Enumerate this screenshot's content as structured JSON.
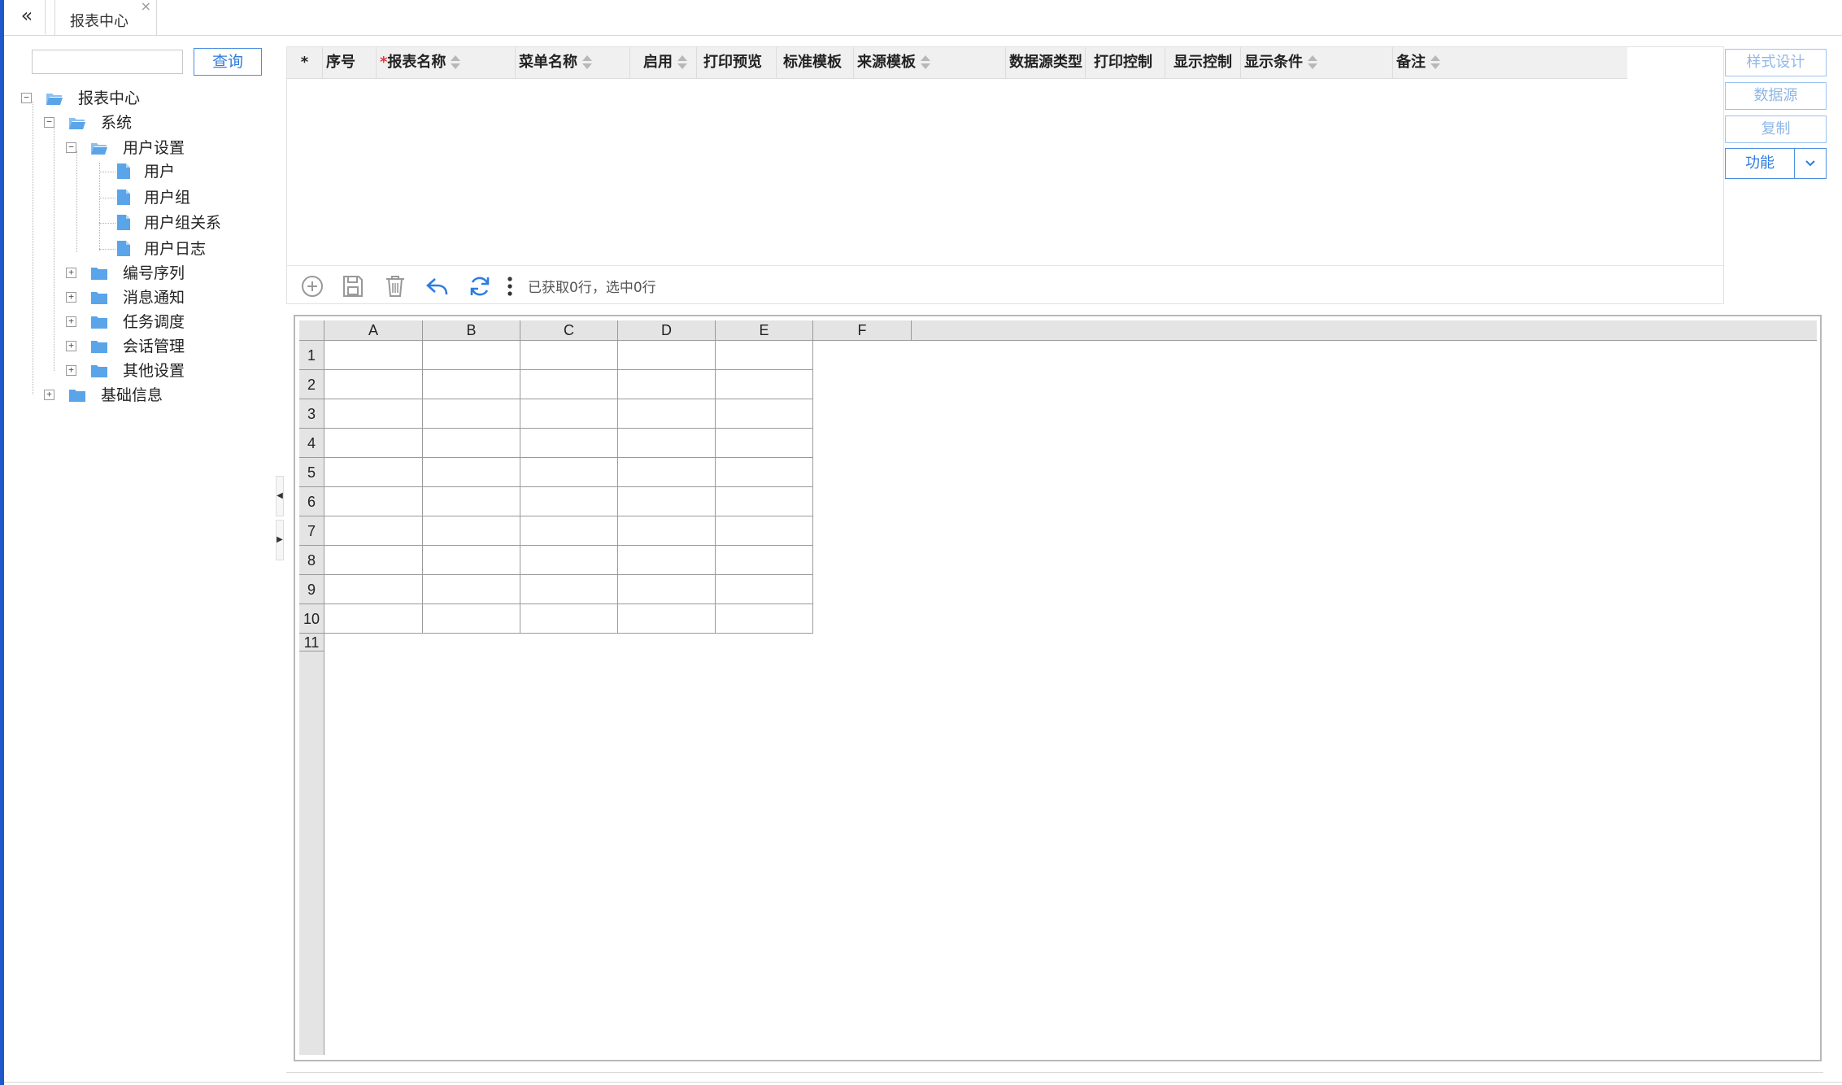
{
  "tabs": {
    "collapse_label": "«",
    "active_tab": "报表中心",
    "close_label": "×"
  },
  "search": {
    "value": "",
    "placeholder": "",
    "query_label": "查询"
  },
  "tree": {
    "root": "报表中心",
    "system": "系统",
    "user_settings": "用户设置",
    "user": "用户",
    "user_group": "用户组",
    "user_group_relation": "用户组关系",
    "user_log": "用户日志",
    "numbering": "编号序列",
    "notifications": "消息通知",
    "task_scheduling": "任务调度",
    "session_management": "会话管理",
    "other_settings": "其他设置",
    "basic_info": "基础信息"
  },
  "grid": {
    "columns": [
      {
        "label": "*",
        "required": false,
        "sortable": false
      },
      {
        "label": "序号",
        "required": false,
        "sortable": false
      },
      {
        "label": "报表名称",
        "required": true,
        "sortable": true
      },
      {
        "label": "菜单名称",
        "required": false,
        "sortable": true
      },
      {
        "label": "启用",
        "required": false,
        "sortable": true
      },
      {
        "label": "打印预览",
        "required": false,
        "sortable": false
      },
      {
        "label": "标准模板",
        "required": false,
        "sortable": false
      },
      {
        "label": "来源模板",
        "required": false,
        "sortable": true
      },
      {
        "label": "数据源类型",
        "required": false,
        "sortable": false
      },
      {
        "label": "打印控制",
        "required": false,
        "sortable": false
      },
      {
        "label": "显示控制",
        "required": false,
        "sortable": false
      },
      {
        "label": "显示条件",
        "required": false,
        "sortable": true
      },
      {
        "label": "备注",
        "required": false,
        "sortable": true
      }
    ],
    "rows": [],
    "toolbar": {
      "icons": [
        "add-icon",
        "save-icon",
        "delete-icon",
        "undo-icon",
        "refresh-icon",
        "more-icon"
      ],
      "status": "已获取0行，选中0行"
    }
  },
  "side_buttons": {
    "style_design": "样式设计",
    "data_source": "数据源",
    "copy": "复制",
    "function": "功能"
  },
  "spreadsheet": {
    "columns": [
      "A",
      "B",
      "C",
      "D",
      "E",
      "F"
    ],
    "rows": [
      "1",
      "2",
      "3",
      "4",
      "5",
      "6",
      "7",
      "8",
      "9",
      "10",
      "11"
    ]
  },
  "colors": {
    "accent": "#2e7ce0",
    "left_edge": "#1f58c8",
    "folder": "#5aa4ea"
  }
}
